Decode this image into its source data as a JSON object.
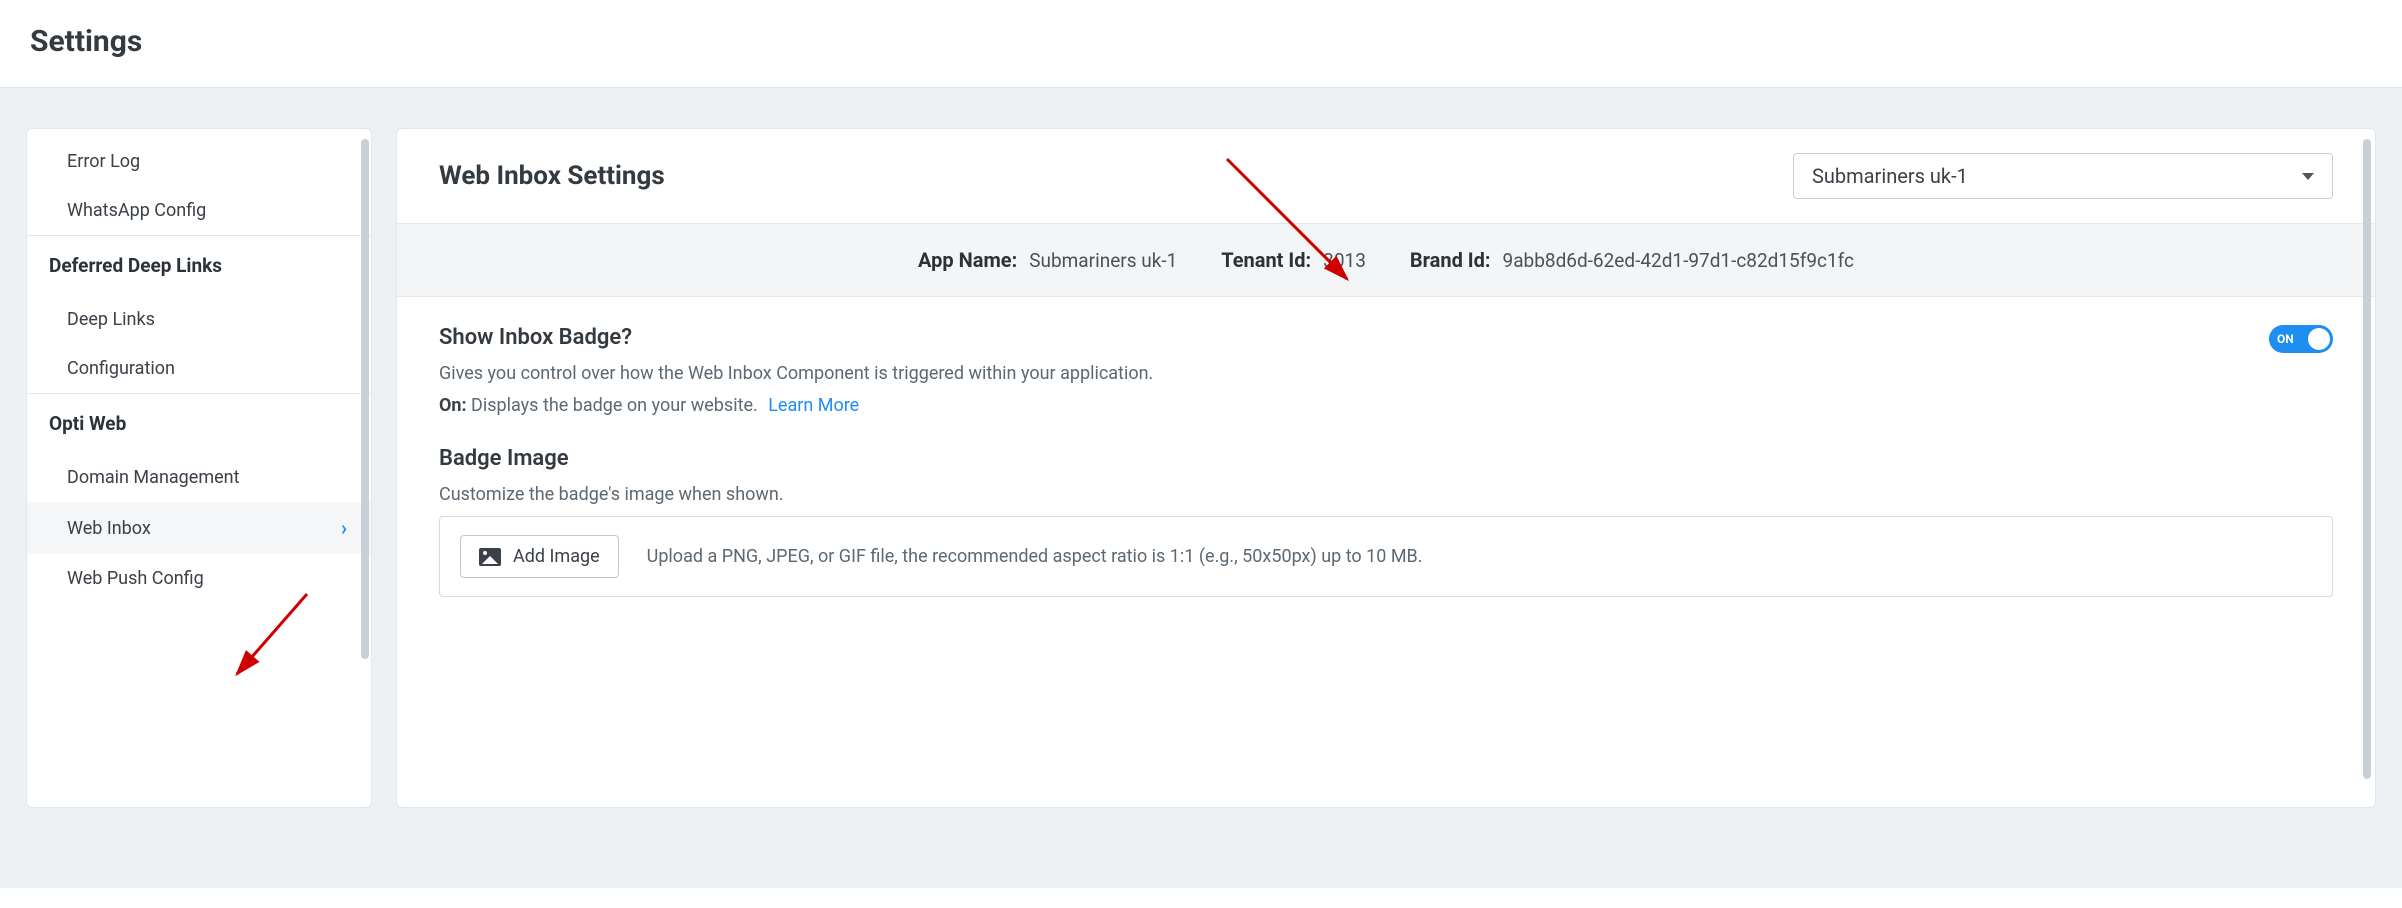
{
  "header": {
    "title": "Settings"
  },
  "sidebar": {
    "items_top": [
      {
        "label": "Error Log"
      },
      {
        "label": "WhatsApp Config"
      }
    ],
    "group1": {
      "title": "Deferred Deep Links",
      "items": [
        {
          "label": "Deep Links"
        },
        {
          "label": "Configuration"
        }
      ]
    },
    "group2": {
      "title": "Opti Web",
      "items": [
        {
          "label": "Domain Management"
        },
        {
          "label": "Web Inbox",
          "active": true
        },
        {
          "label": "Web Push Config"
        }
      ]
    }
  },
  "main": {
    "title": "Web Inbox Settings",
    "app_selector": {
      "selected": "Submariners uk-1"
    },
    "info": {
      "app_name_label": "App Name:",
      "app_name_value": "Submariners uk-1",
      "tenant_id_label": "Tenant Id:",
      "tenant_id_value": "3013",
      "brand_id_label": "Brand Id:",
      "brand_id_value": "9abb8d6d-62ed-42d1-97d1-c82d15f9c1fc"
    },
    "show_badge": {
      "title": "Show Inbox Badge?",
      "desc": "Gives you control over how the Web Inbox Component is triggered within your application.",
      "on_prefix": "On:",
      "on_text": "Displays the badge on your website.",
      "learn_more": "Learn More",
      "toggle_state": "ON"
    },
    "badge_image": {
      "title": "Badge Image",
      "desc": "Customize the badge's image when shown.",
      "button": "Add Image",
      "hint": "Upload a PNG, JPEG, or GIF file, the recommended aspect ratio is 1:1 (e.g., 50x50px) up to 10 MB."
    }
  }
}
